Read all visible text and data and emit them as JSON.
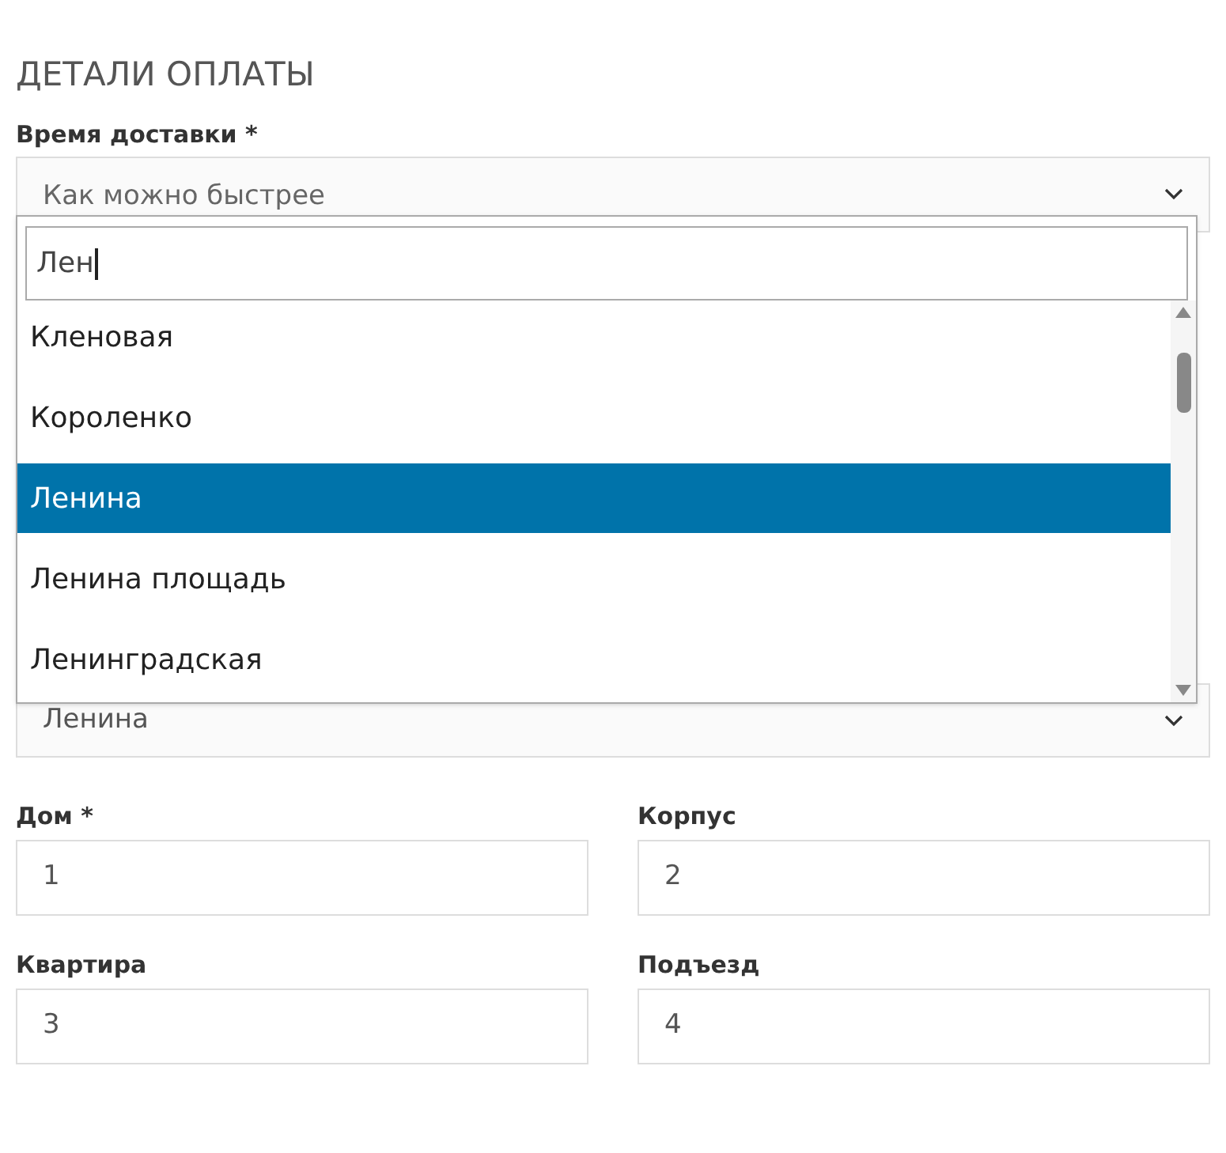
{
  "heading": "ДЕТАЛИ ОПЛАТЫ",
  "delivery": {
    "label": "Время доставки *",
    "value": "Как можно быстрее"
  },
  "street_dropdown": {
    "search_value": "Лен",
    "options": [
      {
        "label": "Кленовая",
        "selected": false
      },
      {
        "label": "Короленко",
        "selected": false
      },
      {
        "label": "Ленина",
        "selected": true
      },
      {
        "label": "Ленина площадь",
        "selected": false
      },
      {
        "label": "Ленинградская",
        "selected": false
      }
    ]
  },
  "street": {
    "value": "Ленина"
  },
  "fields": [
    {
      "label": "Дом *",
      "value": "1"
    },
    {
      "label": "Корпус",
      "value": "2"
    },
    {
      "label": "Квартира",
      "value": "3"
    },
    {
      "label": "Подъезд",
      "value": "4"
    }
  ]
}
